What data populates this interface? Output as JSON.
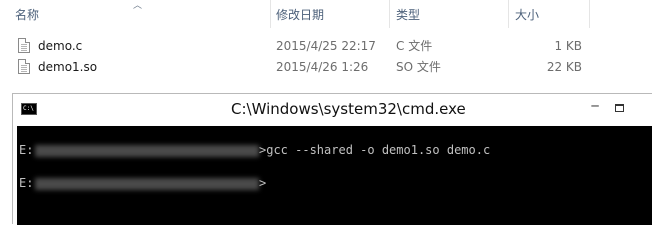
{
  "explorer": {
    "columns": {
      "name": "名称",
      "date": "修改日期",
      "type": "类型",
      "size": "大小"
    },
    "files": [
      {
        "name": "demo.c",
        "date": "2015/4/25 22:17",
        "type": "C 文件",
        "size": "1 KB"
      },
      {
        "name": "demo1.so",
        "date": "2015/4/26 1:26",
        "type": "SO 文件",
        "size": "22 KB"
      }
    ]
  },
  "cmd": {
    "title": "C:\\Windows\\system32\\cmd.exe",
    "icon_label": "C:\\",
    "lines": [
      {
        "prompt_start": "E:",
        "command": ">gcc --shared -o demo1.so demo.c"
      },
      {
        "prompt_start": "E:",
        "command": ">"
      }
    ]
  }
}
